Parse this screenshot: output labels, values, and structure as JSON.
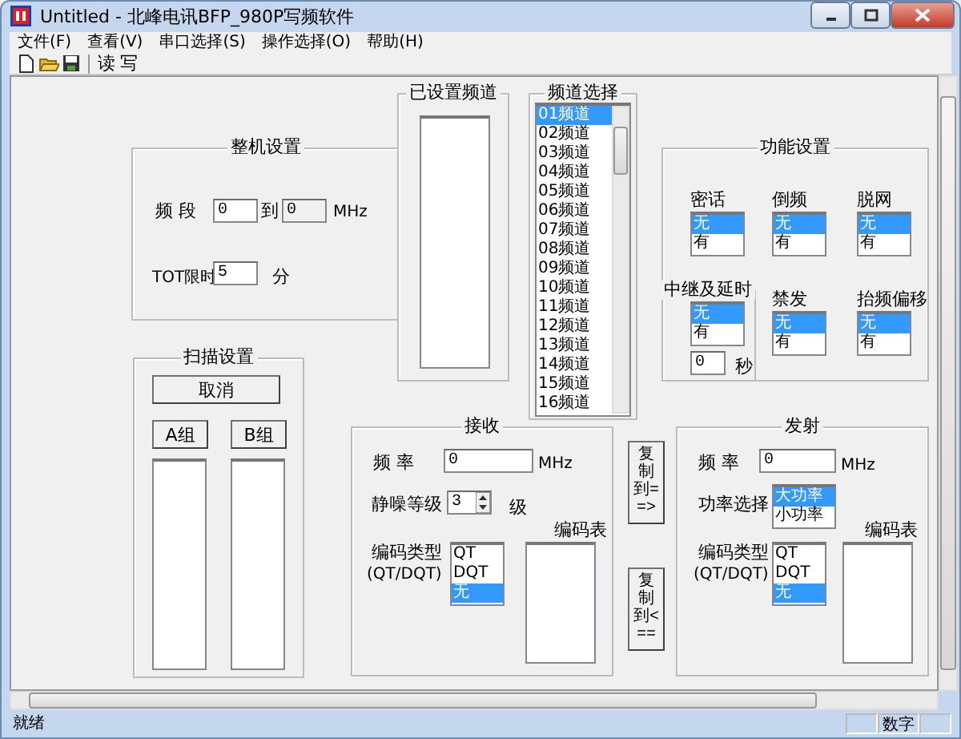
{
  "window": {
    "title": "Untitled - 北峰电讯BFP_980P写频软件"
  },
  "menu": [
    "文件(F)",
    "查看(V)",
    "串口选择(S)",
    "操作选择(O)",
    "帮助(H)"
  ],
  "toolbar": [
    {
      "kind": "new"
    },
    {
      "kind": "open"
    },
    {
      "kind": "save"
    },
    {
      "kind": "text",
      "label": "读"
    },
    {
      "kind": "text",
      "label": "写"
    }
  ],
  "machine": {
    "title": "整机设置",
    "band_label": "频 段",
    "band_from": "0",
    "to_label": "到",
    "band_to": "0",
    "band_to_disabled": true,
    "band_unit": "MHz",
    "tot_label": "TOT限时",
    "tot_value": "5",
    "tot_unit": "分"
  },
  "set_channels": {
    "title": "已设置频道"
  },
  "channel_select": {
    "title": "频道选择",
    "items": [
      {
        "label": "01频道",
        "selected": true
      },
      {
        "label": "02频道",
        "selected": false
      },
      {
        "label": "03频道",
        "selected": false
      },
      {
        "label": "04频道",
        "selected": false
      },
      {
        "label": "05频道",
        "selected": false
      },
      {
        "label": "06频道",
        "selected": false
      },
      {
        "label": "07频道",
        "selected": false
      },
      {
        "label": "08频道",
        "selected": false
      },
      {
        "label": "09频道",
        "selected": false
      },
      {
        "label": "10频道",
        "selected": false
      },
      {
        "label": "11频道",
        "selected": false
      },
      {
        "label": "12频道",
        "selected": false
      },
      {
        "label": "13频道",
        "selected": false
      },
      {
        "label": "14频道",
        "selected": false
      },
      {
        "label": "15频道",
        "selected": false
      },
      {
        "label": "16频道",
        "selected": false
      }
    ]
  },
  "functions": {
    "title": "功能设置",
    "options": [
      {
        "label": "密话",
        "items": [
          {
            "label": "无",
            "selected": true
          },
          {
            "label": "有",
            "selected": false
          }
        ]
      },
      {
        "label": "倒频",
        "items": [
          {
            "label": "无",
            "selected": true
          },
          {
            "label": "有",
            "selected": false
          }
        ]
      },
      {
        "label": "脱网",
        "items": [
          {
            "label": "无",
            "selected": true
          },
          {
            "label": "有",
            "selected": false
          }
        ]
      },
      {
        "label": "禁发",
        "items": [
          {
            "label": "无",
            "selected": true
          },
          {
            "label": "有",
            "selected": false
          }
        ]
      },
      {
        "label": "抬频偏移",
        "items": [
          {
            "label": "无",
            "selected": true
          },
          {
            "label": "有",
            "selected": false
          }
        ]
      }
    ],
    "relay": {
      "title": "中继及延时",
      "items": [
        {
          "label": "无",
          "selected": true
        },
        {
          "label": "有",
          "selected": false
        }
      ],
      "delay_value": "0",
      "delay_unit": "秒"
    }
  },
  "scan": {
    "title": "扫描设置",
    "cancel_button": "取消",
    "group_buttons": [
      "A组",
      "B组"
    ]
  },
  "receive": {
    "title": "接收",
    "freq_label": "频 率",
    "freq_value": "0",
    "freq_unit": "MHz",
    "squelch_label": "静噪等级",
    "squelch_value": "3",
    "squelch_unit": "级",
    "code_type_label": "编码类型",
    "code_type_hint": "(QT/DQT)",
    "code_types": [
      {
        "label": "QT",
        "selected": false
      },
      {
        "label": "DQT",
        "selected": false
      },
      {
        "label": "无",
        "selected": true
      }
    ],
    "code_table_label": "编码表"
  },
  "copy_buttons": [
    "复制到==>",
    "复制到<=="
  ],
  "transmit": {
    "title": "发射",
    "freq_label": "频 率",
    "freq_value": "0",
    "freq_unit": "MHz",
    "power_label": "功率选择",
    "power": [
      {
        "label": "大功率",
        "selected": true
      },
      {
        "label": "小功率",
        "selected": false
      }
    ],
    "code_type_label": "编码类型",
    "code_type_hint": "(QT/DQT)",
    "code_types": [
      {
        "label": "QT",
        "selected": false
      },
      {
        "label": "DQT",
        "selected": false
      },
      {
        "label": "无",
        "selected": true
      }
    ],
    "code_table_label": "编码表"
  },
  "status_bar": {
    "message": "就绪",
    "panels": [
      "数字"
    ]
  }
}
